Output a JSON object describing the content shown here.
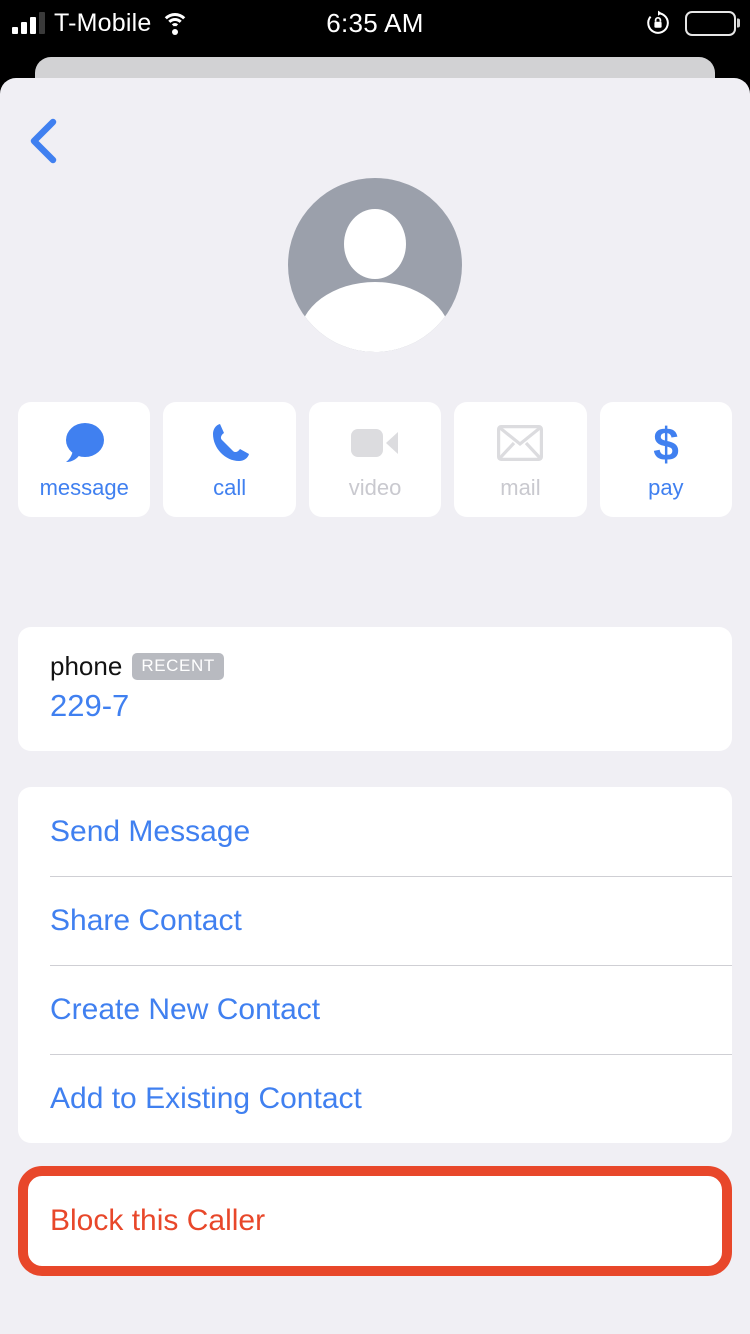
{
  "status_bar": {
    "carrier": "T-Mobile",
    "time": "6:35 AM",
    "signal_icon": "signal-bars-icon",
    "wifi_icon": "wifi-icon",
    "rotation_lock_icon": "rotation-lock-icon",
    "battery_icon": "battery-full-icon"
  },
  "nav": {
    "back_icon": "chevron-left-icon"
  },
  "contact": {
    "avatar_icon": "person-placeholder-avatar",
    "avatar_color": "#9ba0ab"
  },
  "actions": [
    {
      "label": "message",
      "icon": "message-bubble-icon",
      "enabled": true
    },
    {
      "label": "call",
      "icon": "phone-handset-icon",
      "enabled": true
    },
    {
      "label": "video",
      "icon": "video-camera-icon",
      "enabled": false
    },
    {
      "label": "mail",
      "icon": "envelope-icon",
      "enabled": false
    },
    {
      "label": "pay",
      "icon": "dollar-sign-icon",
      "enabled": true
    }
  ],
  "phone_field": {
    "label": "phone",
    "badge": "RECENT",
    "number": "229-7"
  },
  "list_items": [
    {
      "label": "Send Message"
    },
    {
      "label": "Share Contact"
    },
    {
      "label": "Create New Contact"
    },
    {
      "label": "Add to Existing Contact"
    }
  ],
  "block": {
    "label": "Block this Caller",
    "highlight_color": "#e8472a"
  },
  "colors": {
    "accent_blue": "#4080f0",
    "destructive_red": "#e8472a",
    "background": "#f0eff4",
    "card": "#ffffff",
    "disabled_gray": "#c9c9cf"
  }
}
